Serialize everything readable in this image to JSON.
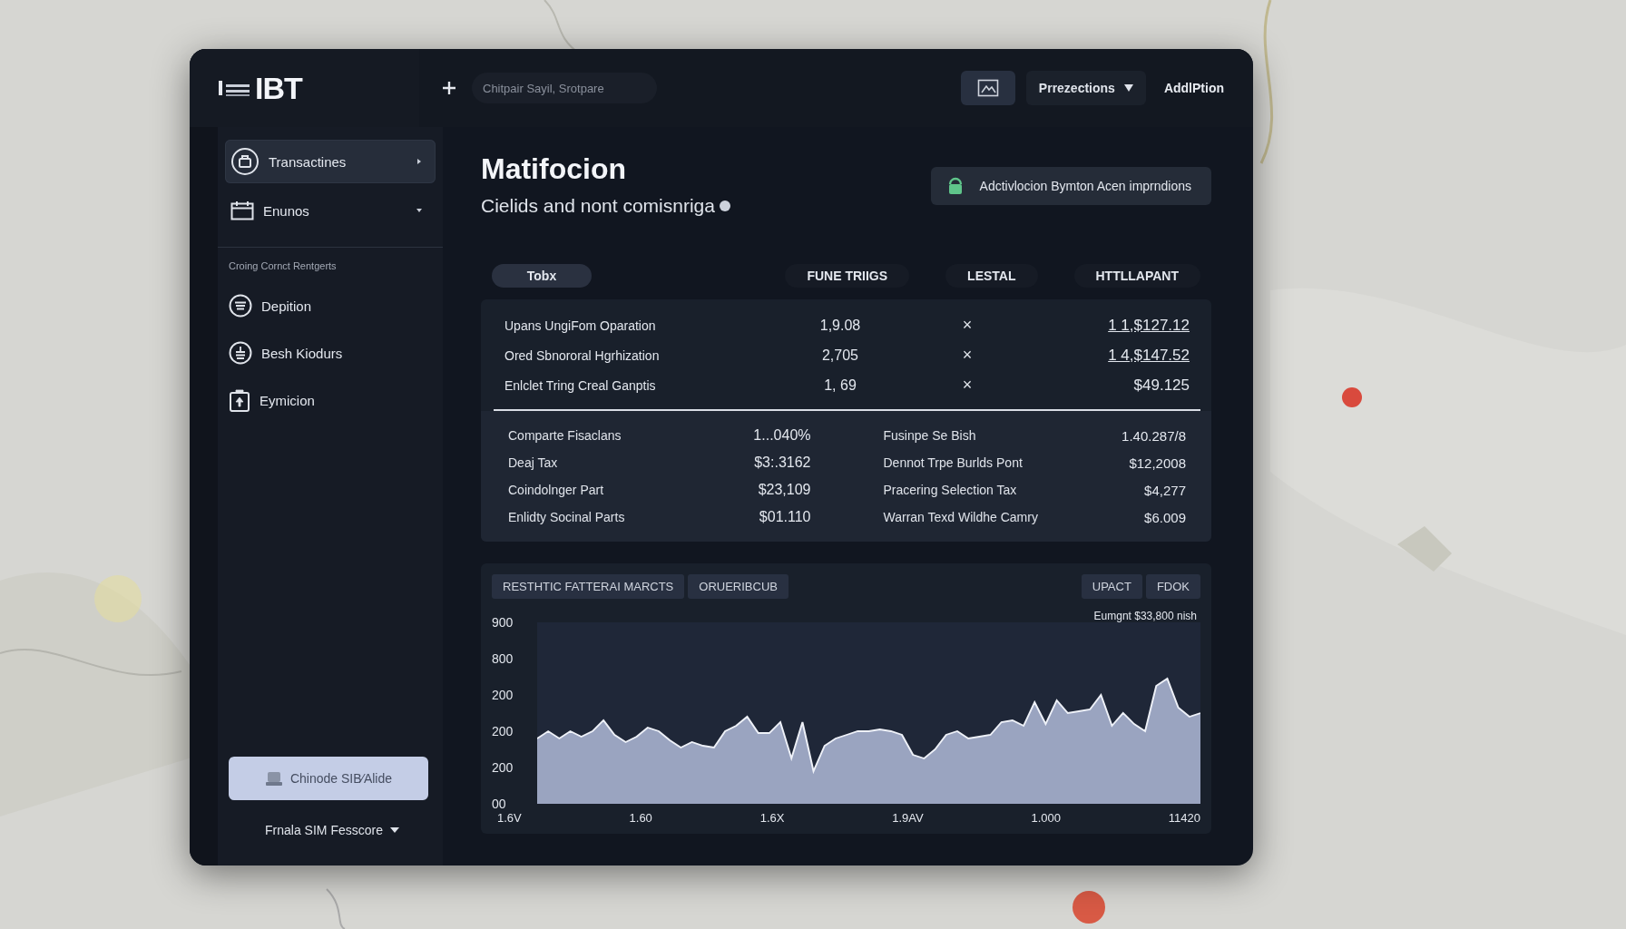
{
  "header": {
    "logo": "IBT",
    "search": {
      "placeholder": "Chitpair Sayil, Srotpare"
    },
    "menu": {
      "label": "Prrezections"
    },
    "action": "AddlPtion"
  },
  "sidebar": {
    "items": [
      {
        "label": "Transactines",
        "selected": true,
        "expanded": false
      },
      {
        "label": "Enunos",
        "selected": false,
        "expanded": true
      }
    ],
    "section": "Croing Cornct Rentgerts",
    "links": [
      {
        "label": "Depition"
      },
      {
        "label": "Besh Kiodurs"
      },
      {
        "label": "Eymicion"
      }
    ],
    "button": "Chinode SIB⁄Alide",
    "footer": "Frnala SIM Fesscore"
  },
  "main": {
    "title": "Matifocion",
    "subtitle": "Cielids and nont comisnriga",
    "notice": "Adctivlocion Bymton Acen imprndions",
    "table": {
      "columns": [
        {
          "label": "Tobx",
          "selected": true
        },
        {
          "label": "FUNE TRIIGS",
          "selected": false
        },
        {
          "label": "LESTAL",
          "selected": false
        },
        {
          "label": "HTTLLAPANT",
          "selected": false
        }
      ],
      "rows": [
        {
          "name": "Upans UngiFom Oparation",
          "count": "1,9.08",
          "mark": "×",
          "amount": "1 1,$127.12",
          "link": true
        },
        {
          "name": "Ored Sbnororal Hgrhization",
          "count": "2,705",
          "mark": "×",
          "amount": "1 4,$147.52",
          "link": true
        },
        {
          "name": "Enlclet Tring Creal Ganptis",
          "count": "1, 69",
          "mark": "×",
          "amount": "$49.125",
          "link": false
        }
      ]
    },
    "summary": [
      {
        "label": "Comparte Fisaclans",
        "value": "1...040%"
      },
      {
        "label": "Fusinpe Se Bish",
        "value": "1.40.287/8"
      },
      {
        "label": "Deaj Tax",
        "value": "$3:.3162"
      },
      {
        "label": "Dennot Trpe Burlds Pont",
        "value": "$12,2008"
      },
      {
        "label": "Coindolnger Part",
        "value": "$23,109"
      },
      {
        "label": "Pracering Selection Tax",
        "value": "$4,277"
      },
      {
        "label": "Enlidty Socinal Parts",
        "value": "$01.110"
      },
      {
        "label": "Warran Texd Wildhe Camry",
        "value": "$6.009"
      }
    ],
    "chart": {
      "tabs": [
        "RESTHTIC FATTERAI MARCTS",
        "ORUERIBCUB"
      ],
      "buttons": [
        "UPACT",
        "FDOK"
      ],
      "note": "Eumgnt $33,800 nish",
      "y_labels": [
        "900",
        "800",
        "200",
        "200",
        "200",
        "00"
      ],
      "x_labels": [
        "1.6V",
        "1.60",
        "1.6X",
        "1.9AV",
        "1.000",
        "11420"
      ]
    }
  }
}
